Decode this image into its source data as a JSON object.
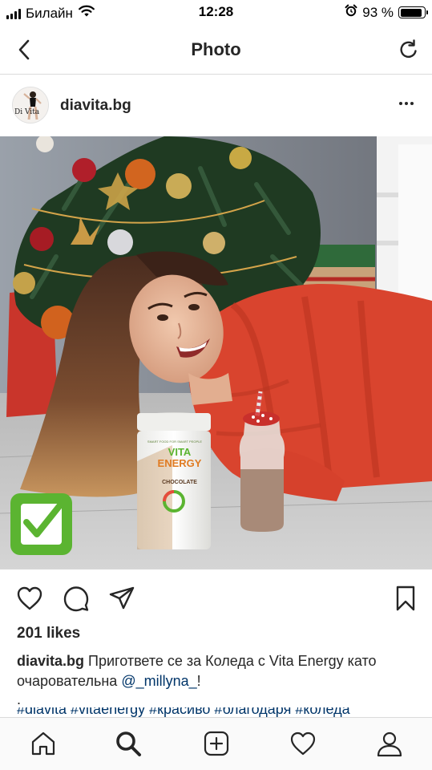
{
  "status_bar": {
    "carrier": "Билайн",
    "time": "12:28",
    "battery_percent": "93 %",
    "battery_level": 0.93
  },
  "nav": {
    "title": "Photo",
    "back_icon": "chevron-left-icon",
    "refresh_icon": "refresh-icon"
  },
  "post": {
    "username": "diavita.bg",
    "avatar_text": "Di Vita",
    "likes": "201 likes",
    "caption_username": "diavita.bg",
    "caption_text": "Пригответе се за Коледа с Vita Energy като очаровательна",
    "caption_mention": "@_millyna_",
    "caption_end": "!",
    "caption_dot": ".",
    "hashtags": "#diavita #vitaenergy #красиво #благодаря #коледа",
    "product": {
      "brand_top": "SMART FOOD FOR SMART PEOPLE",
      "name_line1": "VITA",
      "name_line2": "ENERGY",
      "flavor": "CHOCOLATE"
    }
  },
  "colors": {
    "link": "#003569",
    "text": "#262626",
    "divider": "#dbdbdb",
    "sweater_red": "#d9442e",
    "logo_green": "#5bb431"
  },
  "tab_bar": {
    "items": [
      "home-icon",
      "search-icon",
      "add-post-icon",
      "heart-icon",
      "profile-icon"
    ]
  }
}
